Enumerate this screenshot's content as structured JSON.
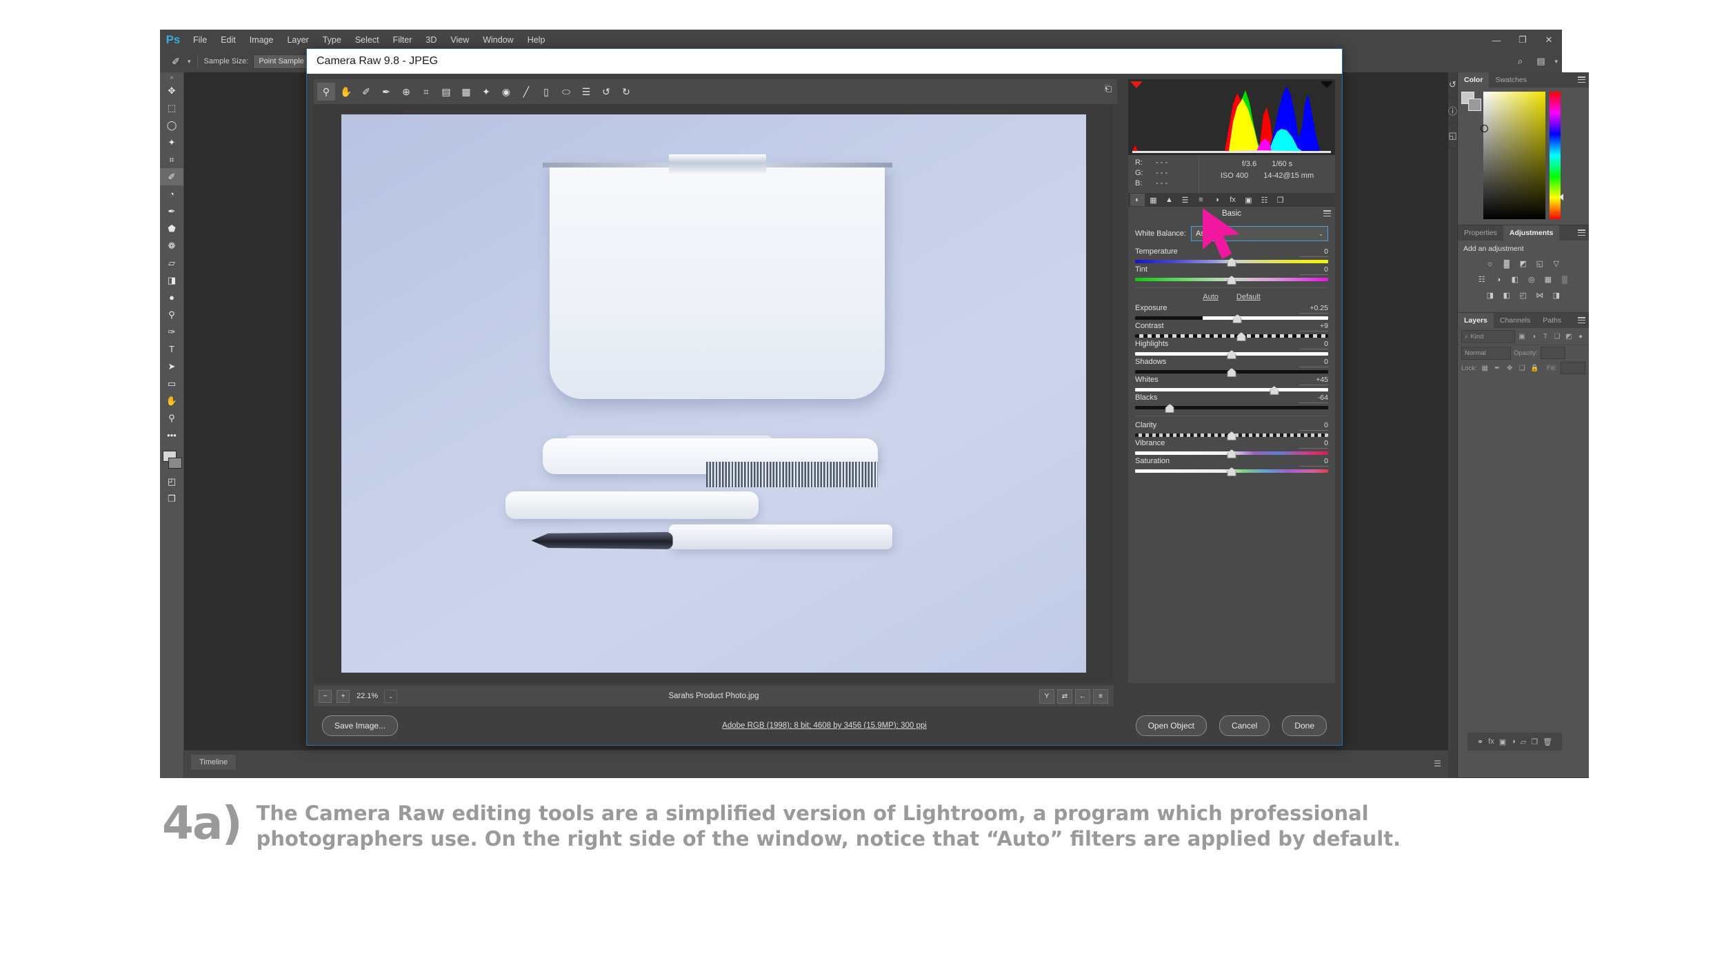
{
  "photoshop": {
    "logo": "Ps",
    "menu": [
      "File",
      "Edit",
      "Image",
      "Layer",
      "Type",
      "Select",
      "Filter",
      "3D",
      "View",
      "Window",
      "Help"
    ],
    "window_controls": [
      {
        "name": "minimize",
        "glyph": "—"
      },
      {
        "name": "restore",
        "glyph": "❐"
      },
      {
        "name": "close",
        "glyph": "✕"
      }
    ],
    "options_bar": {
      "tool_icon": "eyedropper-icon",
      "tool_glyph": "✐",
      "sample_size_label": "Sample Size:",
      "sample_size_value": "Point Sample",
      "right_icons": [
        "search-icon",
        "workspace-icon"
      ],
      "right_glyphs": [
        "⌕",
        "▤"
      ]
    },
    "toolbar": {
      "collapse_glyph": "»",
      "tools": [
        {
          "name": "move-tool",
          "glyph": "✥"
        },
        {
          "name": "rectangular-marquee-tool",
          "glyph": "⬚"
        },
        {
          "name": "lasso-tool",
          "glyph": "◯"
        },
        {
          "name": "quick-selection-tool",
          "glyph": "✦"
        },
        {
          "name": "crop-tool",
          "glyph": "⌗"
        },
        {
          "name": "eyedropper-tool",
          "glyph": "✐",
          "selected": true
        },
        {
          "name": "spot-healing-brush-tool",
          "glyph": "◔"
        },
        {
          "name": "brush-tool",
          "glyph": "✒"
        },
        {
          "name": "clone-stamp-tool",
          "glyph": "⬟"
        },
        {
          "name": "history-brush-tool",
          "glyph": "❁"
        },
        {
          "name": "eraser-tool",
          "glyph": "▱"
        },
        {
          "name": "gradient-tool",
          "glyph": "◨"
        },
        {
          "name": "blur-tool",
          "glyph": "●"
        },
        {
          "name": "dodge-tool",
          "glyph": "⚲"
        },
        {
          "name": "pen-tool",
          "glyph": "✑"
        },
        {
          "name": "type-tool",
          "glyph": "T"
        },
        {
          "name": "path-selection-tool",
          "glyph": "➤"
        },
        {
          "name": "rectangle-tool",
          "glyph": "▭"
        },
        {
          "name": "hand-tool",
          "glyph": "✋"
        },
        {
          "name": "zoom-tool",
          "glyph": "⚲"
        },
        {
          "name": "more-tools",
          "glyph": "•••"
        },
        {
          "name": "quick-mask-tool",
          "glyph": "◰"
        },
        {
          "name": "screen-mode-tool",
          "glyph": "❐"
        }
      ]
    },
    "timeline": {
      "tab_label": "Timeline",
      "menu_glyph": "☰"
    },
    "dock_rail": [
      {
        "name": "history-icon",
        "glyph": "↺"
      },
      {
        "name": "info-icon",
        "glyph": "ⓘ"
      },
      {
        "name": "libraries-icon",
        "glyph": "◱"
      }
    ],
    "color_panel": {
      "tabs": [
        "Color",
        "Swatches"
      ],
      "active_tab": "Color"
    },
    "adjustments_panel": {
      "tabs": [
        "Properties",
        "Adjustments"
      ],
      "active_tab": "Adjustments",
      "title": "Add an adjustment",
      "icons": [
        [
          "brightness-contrast-icon",
          "levels-icon",
          "curves-icon",
          "exposure-icon",
          "vibrance-icon"
        ],
        [
          "color-balance-icon",
          "black-white-icon",
          "photo-filter-icon",
          "channel-mixer-icon",
          "color-lookup-icon",
          "posterize-icon"
        ],
        [
          "invert-icon",
          "threshold-icon",
          "selective-color-icon",
          "gradient-map-icon",
          "hue-saturation-icon"
        ]
      ],
      "glyphs": [
        [
          "☼",
          "▓",
          "◩",
          "◱",
          "▽"
        ],
        [
          "☷",
          "◑",
          "◧",
          "◎",
          "▦",
          "▒"
        ],
        [
          "◨",
          "◧",
          "◰",
          "⋈",
          "◨"
        ]
      ]
    },
    "layers_panel": {
      "tabs": [
        "Layers",
        "Channels",
        "Paths"
      ],
      "active_tab": "Layers",
      "filter_placeholder": "Kind",
      "filter_icons": [
        "pixel-layer-filter-icon",
        "adjustment-layer-filter-icon",
        "type-layer-filter-icon",
        "shape-layer-filter-icon",
        "smart-object-filter-icon",
        "filter-toggle-icon"
      ],
      "filter_glyphs": [
        "▣",
        "◑",
        "T",
        "❑",
        "◩",
        "●"
      ],
      "blend_mode": "Normal",
      "opacity_label": "Opacity:",
      "lock_label": "Lock:",
      "fill_label": "Fill:",
      "lock_icons": [
        "lock-transparent-pixels-icon",
        "lock-image-pixels-icon",
        "lock-position-icon",
        "lock-artboard-icon",
        "lock-all-icon"
      ],
      "lock_glyphs": [
        "▦",
        "✒",
        "✥",
        "❑",
        "ὑ2"
      ],
      "bottom_icons": [
        "link-layers-icon",
        "layer-style-icon",
        "layer-mask-icon",
        "new-adjustment-layer-icon",
        "new-group-icon",
        "new-layer-icon",
        "delete-layer-icon"
      ],
      "bottom_glyphs": [
        "⚭",
        "fx",
        "▣",
        "◑",
        "▱",
        "❐",
        "Ὕ1"
      ]
    }
  },
  "camera_raw": {
    "title": "Camera Raw 9.8  -  JPEG",
    "toolbar_tools": [
      {
        "name": "zoom-tool",
        "glyph": "⚲",
        "selected": true
      },
      {
        "name": "hand-tool",
        "glyph": "✋"
      },
      {
        "name": "white-balance-tool",
        "glyph": "✐"
      },
      {
        "name": "color-sampler-tool",
        "glyph": "✒"
      },
      {
        "name": "targeted-adjustment-tool",
        "glyph": "⊕"
      },
      {
        "name": "crop-tool",
        "glyph": "⌗"
      },
      {
        "name": "straighten-tool",
        "glyph": "▤"
      },
      {
        "name": "transform-tool",
        "glyph": "▦"
      },
      {
        "name": "spot-removal-tool",
        "glyph": "✦"
      },
      {
        "name": "red-eye-removal-tool",
        "glyph": "◉"
      },
      {
        "name": "adjustment-brush-tool",
        "glyph": "╱"
      },
      {
        "name": "graduated-filter-tool",
        "glyph": "▯"
      },
      {
        "name": "radial-filter-tool",
        "glyph": "⬭"
      },
      {
        "name": "presets-tool",
        "glyph": "☰"
      },
      {
        "name": "rotate-left-tool",
        "glyph": "↺"
      },
      {
        "name": "rotate-right-tool",
        "glyph": "↻"
      }
    ],
    "toolbar_right_icon": "preferences-icon",
    "toolbar_right_glyph": "⎗",
    "zoom": {
      "minus": "−",
      "plus": "+",
      "value": "22.1%",
      "caret": "⌄"
    },
    "filename": "Sarahs Product Photo.jpg",
    "preview_icons": [
      "preview-toggle-icon",
      "before-after-icon",
      "swap-settings-icon",
      "preview-preferences-icon"
    ],
    "preview_glyphs": [
      "Y",
      "⇄",
      "←",
      "≡"
    ],
    "exif": {
      "r_label": "R:",
      "r_value": "- - -",
      "g_label": "G:",
      "g_value": "- - -",
      "b_label": "B:",
      "b_value": "- - -",
      "aperture": "f/3.6",
      "shutter": "1/60 s",
      "iso": "ISO 400",
      "lens": "14-42@15 mm"
    },
    "panel_tabs": [
      {
        "name": "basic-tab",
        "glyph": "◐",
        "selected": true
      },
      {
        "name": "tone-curve-tab",
        "glyph": "▦"
      },
      {
        "name": "detail-tab",
        "glyph": "▲"
      },
      {
        "name": "hsl-grayscale-tab",
        "glyph": "☰"
      },
      {
        "name": "split-toning-tab",
        "glyph": "≡"
      },
      {
        "name": "lens-corrections-tab",
        "glyph": "◑"
      },
      {
        "name": "effects-tab",
        "glyph": "fx"
      },
      {
        "name": "camera-calibration-tab",
        "glyph": "▣"
      },
      {
        "name": "presets-tab",
        "glyph": "☷"
      },
      {
        "name": "snapshots-tab",
        "glyph": "❐"
      }
    ],
    "panel_title": "Basic",
    "white_balance": {
      "label": "White Balance:",
      "value": "As Shot",
      "caret": "⌄"
    },
    "auto_label": "Auto",
    "default_label": "Default",
    "sliders_group1": [
      {
        "name": "Temperature",
        "value": "0",
        "pos": 50,
        "track": "tr-temp"
      },
      {
        "name": "Tint",
        "value": "0",
        "pos": 50,
        "track": "tr-tint"
      }
    ],
    "sliders_group2": [
      {
        "name": "Exposure",
        "value": "+0.25",
        "pos": 53,
        "track": "tr-plain"
      },
      {
        "name": "Contrast",
        "value": "+9",
        "pos": 55,
        "track": "tr-contrast"
      },
      {
        "name": "Highlights",
        "value": "0",
        "pos": 50,
        "track": "tr-white"
      },
      {
        "name": "Shadows",
        "value": "0",
        "pos": 50,
        "track": "tr-black"
      },
      {
        "name": "Whites",
        "value": "+45",
        "pos": 72,
        "track": "tr-white"
      },
      {
        "name": "Blacks",
        "value": "-64",
        "pos": 18,
        "track": "tr-black"
      }
    ],
    "sliders_group3": [
      {
        "name": "Clarity",
        "value": "0",
        "pos": 50,
        "track": "tr-clarity"
      },
      {
        "name": "Vibrance",
        "value": "0",
        "pos": 50,
        "track": "tr-vib"
      },
      {
        "name": "Saturation",
        "value": "0",
        "pos": 50,
        "track": "tr-sat"
      }
    ],
    "footer": {
      "save_image": "Save Image...",
      "metadata": "Adobe RGB (1998); 8 bit; 4608 by 3456 (15.9MP); 300 ppi",
      "open_object": "Open Object",
      "cancel": "Cancel",
      "done": "Done"
    }
  },
  "caption": {
    "number": "4a)",
    "text": "The Camera Raw editing tools are a simplified version of Lightroom, a program which professional photographers use. On the right side of the window, notice that “Auto” filters are applied by default."
  },
  "colors": {
    "cursor": "#f0189e",
    "accent_blue": "#4a9fe0",
    "caption_gray": "#9a9a9a",
    "ps_chrome": "#535353"
  }
}
